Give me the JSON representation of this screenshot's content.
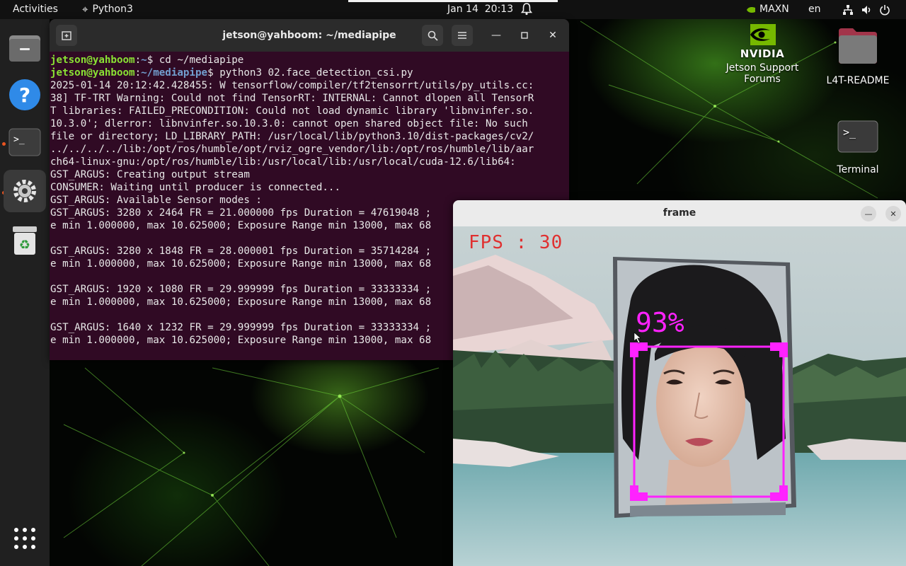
{
  "topbar": {
    "activities": "Activities",
    "app_name": "Python3",
    "date": "Jan 14",
    "time": "20:13",
    "power_mode": "MAXN",
    "language": "en"
  },
  "dock": {
    "items": [
      {
        "name": "Files",
        "icon": "folder-icon"
      },
      {
        "name": "Help",
        "icon": "help-icon"
      },
      {
        "name": "Terminal",
        "icon": "terminal-icon"
      },
      {
        "name": "Settings",
        "icon": "settings-icon"
      },
      {
        "name": "Trash",
        "icon": "trash-icon"
      }
    ],
    "show_apps_icon": "app-grid-icon"
  },
  "desktop": {
    "icons": [
      {
        "label": "Jetson Support Forums",
        "line1": "Jetson Support",
        "line2": "Forums",
        "icon": "nvidia-logo-icon"
      },
      {
        "label": "L4T-README",
        "icon": "folder-icon"
      },
      {
        "label": "Terminal",
        "icon": "terminal-icon"
      }
    ],
    "nvidia_wordmark": "NVIDIA"
  },
  "terminal": {
    "title": "jetson@yahboom: ~/mediapipe",
    "prompt_user": "jetson@yahboom",
    "prompt_sep": ":",
    "line1": {
      "path": "~",
      "cmd": "$ cd ~/mediapipe"
    },
    "line2": {
      "path": "~/mediapipe",
      "cmd": "$ python3 02.face_detection_csi.py"
    },
    "output": [
      "2025-01-14 20:12:42.428455: W tensorflow/compiler/tf2tensorrt/utils/py_utils.cc:",
      "38] TF-TRT Warning: Could not find TensorRT: INTERNAL: Cannot dlopen all TensorR",
      "T libraries: FAILED_PRECONDITION: Could not load dynamic library 'libnvinfer.so.",
      "10.3.0'; dlerror: libnvinfer.so.10.3.0: cannot open shared object file: No such",
      "file or directory; LD_LIBRARY_PATH: /usr/local/lib/python3.10/dist-packages/cv2/",
      "../../../../lib:/opt/ros/humble/opt/rviz_ogre_vendor/lib:/opt/ros/humble/lib/aar",
      "ch64-linux-gnu:/opt/ros/humble/lib:/usr/local/lib:/usr/local/cuda-12.6/lib64:",
      "GST_ARGUS: Creating output stream",
      "CONSUMER: Waiting until producer is connected...",
      "GST_ARGUS: Available Sensor modes :",
      "GST_ARGUS: 3280 x 2464 FR = 21.000000 fps Duration = 47619048 ;",
      "e min 1.000000, max 10.625000; Exposure Range min 13000, max 68",
      "",
      "GST_ARGUS: 3280 x 1848 FR = 28.000001 fps Duration = 35714284 ;",
      "e min 1.000000, max 10.625000; Exposure Range min 13000, max 68",
      "",
      "GST_ARGUS: 1920 x 1080 FR = 29.999999 fps Duration = 33333334 ;",
      "e min 1.000000, max 10.625000; Exposure Range min 13000, max 68",
      "",
      "GST_ARGUS: 1640 x 1232 FR = 29.999999 fps Duration = 33333334 ;",
      "e min 1.000000, max 10.625000; Exposure Range min 13000, max 68"
    ]
  },
  "frame_window": {
    "title": "frame",
    "fps_label": "FPS : 30",
    "detection_score": "93%",
    "overlay_color": "#ff22ff",
    "fps_color": "#e03030"
  },
  "colors": {
    "terminal_bg": "#300a24",
    "prompt_user": "#8ae234",
    "prompt_path": "#729fcf",
    "accent": "#e95420"
  }
}
